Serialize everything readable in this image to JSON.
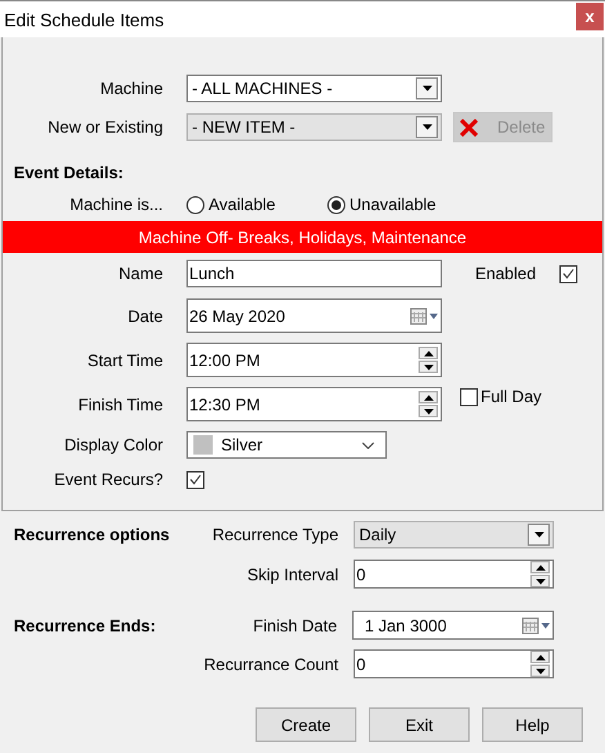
{
  "window": {
    "title": "Edit Schedule Items",
    "close": "x"
  },
  "machine": {
    "label": "Machine",
    "value": "- ALL MACHINES -",
    "disabled": false
  },
  "item": {
    "label": "New or Existing",
    "value": "- NEW ITEM -",
    "disabled": true
  },
  "delete_button": {
    "label": "Delete",
    "disabled": true
  },
  "event_details": {
    "heading": "Event Details:",
    "availability_label": "Machine is...",
    "banner": "Machine Off- Breaks, Holidays, Maintenance"
  },
  "availability_options": [
    {
      "label": "Available",
      "selected": false
    },
    {
      "label": "Unavailable",
      "selected": true
    }
  ],
  "name": {
    "label": "Name",
    "value": "Lunch"
  },
  "enabled": {
    "label": "Enabled",
    "checked": true
  },
  "date": {
    "label": "Date",
    "value": "26 May 2020"
  },
  "start_time": {
    "label": "Start Time",
    "value": "12:00 PM"
  },
  "finish_time": {
    "label": "Finish Time",
    "value": "12:30 PM"
  },
  "full_day": {
    "label": "Full Day",
    "checked": false
  },
  "display_color": {
    "label": "Display Color",
    "value": "Silver",
    "color": "#c0c0c0"
  },
  "event_recurs": {
    "label": "Event Recurs?",
    "checked": true
  },
  "recurrence": {
    "heading": "Recurrence options",
    "type_label": "Recurrence Type",
    "type_value": "Daily",
    "skip_label": "Skip Interval",
    "skip_value": "0"
  },
  "recurrence_ends": {
    "heading": "Recurrence Ends:",
    "finish_label": "Finish Date",
    "finish_value": "1 Jan  3000",
    "count_label": "Recurrance Count",
    "count_value": "0"
  },
  "buttons": [
    "Create",
    "Exit",
    "Help"
  ]
}
